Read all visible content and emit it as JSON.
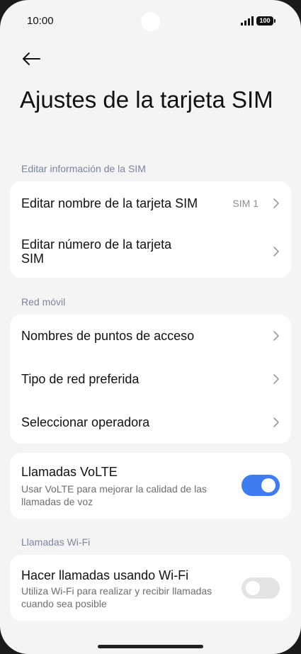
{
  "status_bar": {
    "time": "10:00",
    "battery": "100"
  },
  "page": {
    "title": "Ajustes de la tarjeta SIM"
  },
  "sections": {
    "sim_info": {
      "label": "Editar información de la SIM",
      "rows": [
        {
          "label": "Editar nombre de la tarjeta SIM",
          "value": "SIM 1"
        },
        {
          "label": "Editar número de la tarjeta SIM"
        }
      ]
    },
    "mobile_network": {
      "label": "Red móvil",
      "rows": [
        {
          "label": "Nombres de puntos de acceso"
        },
        {
          "label": "Tipo de red preferida"
        },
        {
          "label": "Seleccionar operadora"
        }
      ]
    },
    "volte": {
      "title": "Llamadas VoLTE",
      "subtitle": "Usar VoLTE para mejorar la calidad de las llamadas de voz",
      "enabled": true
    },
    "wifi_calls": {
      "label": "Llamadas Wi-Fi",
      "title": "Hacer llamadas usando Wi-Fi",
      "subtitle": "Utiliza Wi-Fi para realizar y recibir llamadas cuando sea posible",
      "enabled": false
    }
  },
  "colors": {
    "accent": "#3e7df1",
    "background": "#f4f4f4",
    "card": "#ffffff",
    "section_label": "#7a86a0"
  }
}
